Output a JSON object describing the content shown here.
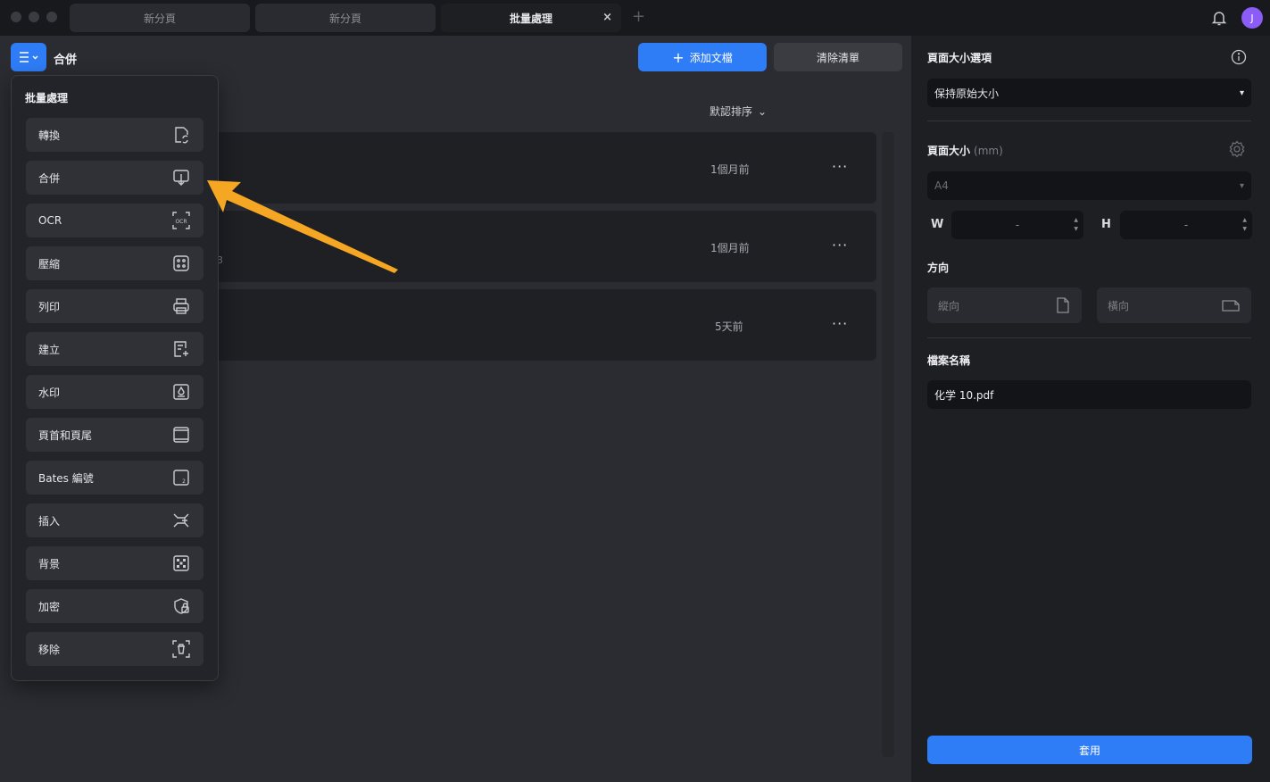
{
  "tabs": [
    {
      "label": "新分頁"
    },
    {
      "label": "新分頁"
    },
    {
      "label": "批量處理",
      "close": "×"
    }
  ],
  "tab_add": "+",
  "avatar": {
    "initial": "J"
  },
  "toolbar": {
    "current_tool": "合併",
    "add_button": "添加文檔",
    "add_icon": "+",
    "clear_button": "清除清單"
  },
  "sort": {
    "label": "默認排序",
    "chevron": "⌄"
  },
  "files": [
    {
      "time": "1個月前",
      "more": "···"
    },
    {
      "time": "1個月前",
      "more": "···"
    },
    {
      "time": "5天前",
      "more": "···"
    }
  ],
  "file_stub": "3",
  "menu": {
    "title": "批量處理",
    "items": [
      {
        "label": "轉換",
        "icon": "convert-icon"
      },
      {
        "label": "合併",
        "icon": "combine-icon"
      },
      {
        "label": "OCR",
        "icon": "ocr-icon"
      },
      {
        "label": "壓縮",
        "icon": "compress-icon"
      },
      {
        "label": "列印",
        "icon": "print-icon"
      },
      {
        "label": "建立",
        "icon": "create-icon"
      },
      {
        "label": "水印",
        "icon": "watermark-icon"
      },
      {
        "label": "頁首和頁尾",
        "icon": "header-footer-icon"
      },
      {
        "label": "Bates 編號",
        "icon": "bates-icon"
      },
      {
        "label": "插入",
        "icon": "insert-icon"
      },
      {
        "label": "背景",
        "icon": "background-icon"
      },
      {
        "label": "加密",
        "icon": "encrypt-icon"
      },
      {
        "label": "移除",
        "icon": "remove-icon"
      }
    ]
  },
  "panel": {
    "page_size_options_label": "頁面大小選項",
    "page_size_option_value": "保持原始大小",
    "page_size_label": "頁面大小",
    "page_size_unit": "(mm)",
    "page_size_value": "A4",
    "w_label": "W",
    "h_label": "H",
    "w_value": "-",
    "h_value": "-",
    "orientation_label": "方向",
    "portrait": "縱向",
    "landscape": "橫向",
    "filename_label": "檔案名稱",
    "filename_value": "化学 10.pdf",
    "apply": "套用",
    "select_arrow": "▾"
  },
  "colors": {
    "accent": "#2f7df6",
    "arrow": "#f5a623",
    "avatar": "#8b5cf6"
  }
}
